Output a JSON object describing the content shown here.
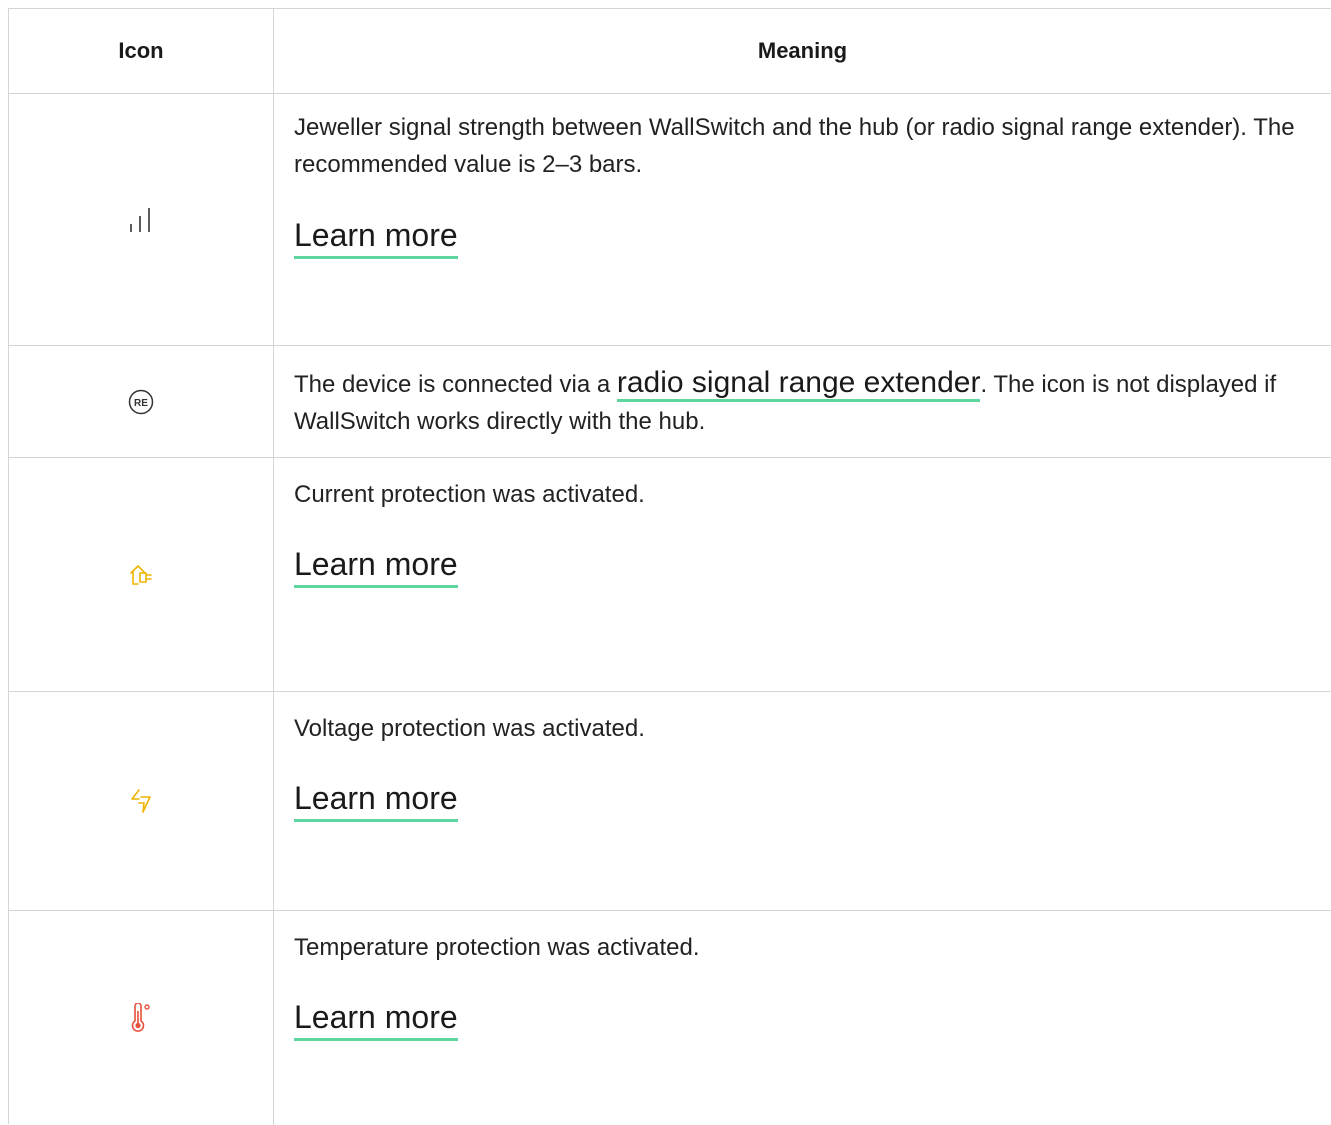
{
  "header": {
    "icon_col": "Icon",
    "meaning_col": "Meaning"
  },
  "rows": [
    {
      "icon": "signal-strength-icon",
      "description": "Jeweller signal strength between WallSwitch and the hub (or radio signal range extender). The recommended value is 2–3 bars.",
      "link": "Learn more"
    },
    {
      "icon": "range-extender-icon",
      "icon_text": "RE",
      "description_before": "The device is connected via a ",
      "description_link": "radio signal range extender",
      "description_after": ". The icon is not displayed if WallSwitch works directly with the hub."
    },
    {
      "icon": "current-protection-icon",
      "description": "Current protection was activated.",
      "link": "Learn more"
    },
    {
      "icon": "voltage-protection-icon",
      "description": "Voltage protection was activated.",
      "link": "Learn more"
    },
    {
      "icon": "temperature-protection-icon",
      "description": "Temperature protection was activated.",
      "link": "Learn more"
    }
  ],
  "colors": {
    "link_underline": "#5fd6a0",
    "warning_icon": "#f0b400",
    "danger_icon": "#e8503a",
    "border": "#d4d4d4"
  }
}
